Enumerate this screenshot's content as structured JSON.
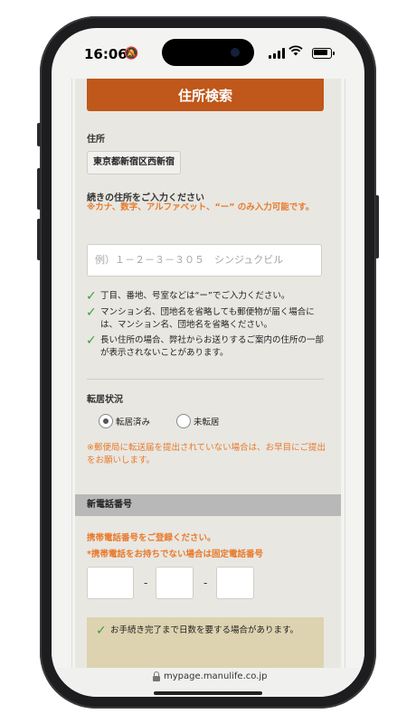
{
  "status_bar": {
    "time": "16:06",
    "mute_icon": "bell-slash-icon"
  },
  "address": {
    "search_button_label": "住所検索",
    "prefecture_label": "住所",
    "prefecture_value": "東京都新宿区西新宿",
    "continue_label": "続きの住所をご入力ください",
    "continue_note": "※カナ、数字、アルファベット、“ー” のみ入力可能です。",
    "address_placeholder": "例）１－２－３－３０５　シンジュクビル",
    "notes": [
      "丁目、番地、号室などは“ー”でご入力ください。",
      "マンション名、団地名を省略しても郵便物が届く場合には、マンション名、団地名を省略ください。",
      "長い住所の場合、弊社からお送りするご案内の住所の一部が表示されないことがあります。"
    ]
  },
  "moving": {
    "label": "転居状況",
    "options": [
      "転居済み",
      "未転居"
    ],
    "selected": "転居済み",
    "note": "※郵便局に転送届を提出されていない場合は、お早目にご提出をお願いします。"
  },
  "phone": {
    "section_title": "新電話番号",
    "instruction": "携帯電話番号をご登録ください。",
    "sub_instruction": "*携帯電話をお持ちでない場合は固定電話番号",
    "separator": "-"
  },
  "info": {
    "text": "お手続き完了まで日数を要する場合があります。"
  },
  "browser": {
    "url": "mypage.manulife.co.jp"
  },
  "colors": {
    "accent": "#c0571b",
    "warning": "#e97a2a",
    "check": "#3aa13a",
    "info_bg": "#ddd3b0"
  }
}
